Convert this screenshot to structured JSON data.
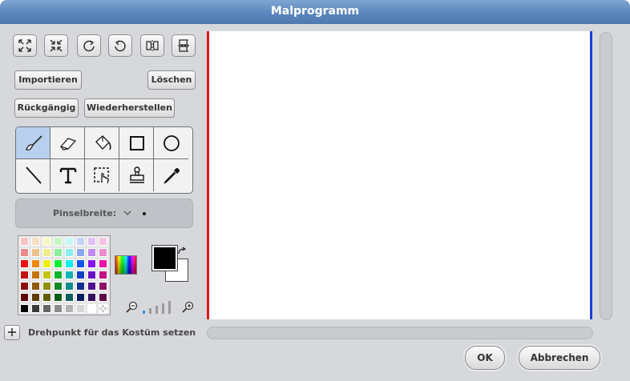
{
  "window": {
    "title": "Malprogramm"
  },
  "transform_buttons": [
    {
      "name": "grow-icon"
    },
    {
      "name": "shrink-icon"
    },
    {
      "name": "rotate-left-icon"
    },
    {
      "name": "rotate-right-icon"
    },
    {
      "name": "flip-horizontal-icon"
    },
    {
      "name": "flip-vertical-icon"
    }
  ],
  "buttons": {
    "import": "Importieren",
    "clear": "Löschen",
    "undo": "Rückgängig",
    "redo": "Wiederherstellen",
    "ok": "OK",
    "cancel": "Abbrechen"
  },
  "tools": [
    {
      "name": "brush-icon",
      "selected": true
    },
    {
      "name": "eraser-icon"
    },
    {
      "name": "fill-bucket-icon"
    },
    {
      "name": "rectangle-icon"
    },
    {
      "name": "ellipse-icon"
    },
    {
      "name": "line-icon"
    },
    {
      "name": "text-icon"
    },
    {
      "name": "select-icon"
    },
    {
      "name": "stamp-icon"
    },
    {
      "name": "eyedropper-icon"
    }
  ],
  "brush": {
    "label": "Pinselbreite:"
  },
  "palette": {
    "rows": [
      [
        "#f7c2c2",
        "#f7dfc2",
        "#f7f7c2",
        "#c2f7c2",
        "#c2f7f7",
        "#c2d4f7",
        "#dfc2f7",
        "#f7c2e4"
      ],
      [
        "#ee8a8a",
        "#eec28a",
        "#eeee8a",
        "#8aee9a",
        "#8aeeee",
        "#8aa6ee",
        "#c08aee",
        "#ee8ad0"
      ],
      [
        "#ee1111",
        "#ee8811",
        "#eeee11",
        "#11ee33",
        "#11eeee",
        "#1155ee",
        "#8811ee",
        "#ee11aa"
      ],
      [
        "#c41010",
        "#c47410",
        "#c4c410",
        "#10b42a",
        "#10b4b4",
        "#1040c4",
        "#6a10c4",
        "#c41088"
      ],
      [
        "#8e1010",
        "#8e5a10",
        "#8e8e10",
        "#108a25",
        "#108a8a",
        "#10308e",
        "#50108e",
        "#8e1068"
      ],
      [
        "#600a0a",
        "#603c0a",
        "#60600a",
        "#0a5e18",
        "#0a5e5e",
        "#0a205e",
        "#36105e",
        "#5e0a46"
      ],
      [
        "#000000",
        "#3a3a3a",
        "#666666",
        "#8c8c8c",
        "#b2b2b2",
        "#d6d6d6",
        "#ffffff",
        "checker"
      ]
    ]
  },
  "colors": {
    "foreground": "#000000",
    "background": "#ffffff"
  },
  "pivot": {
    "label": "Drehpunkt für das Kostüm setzen"
  }
}
